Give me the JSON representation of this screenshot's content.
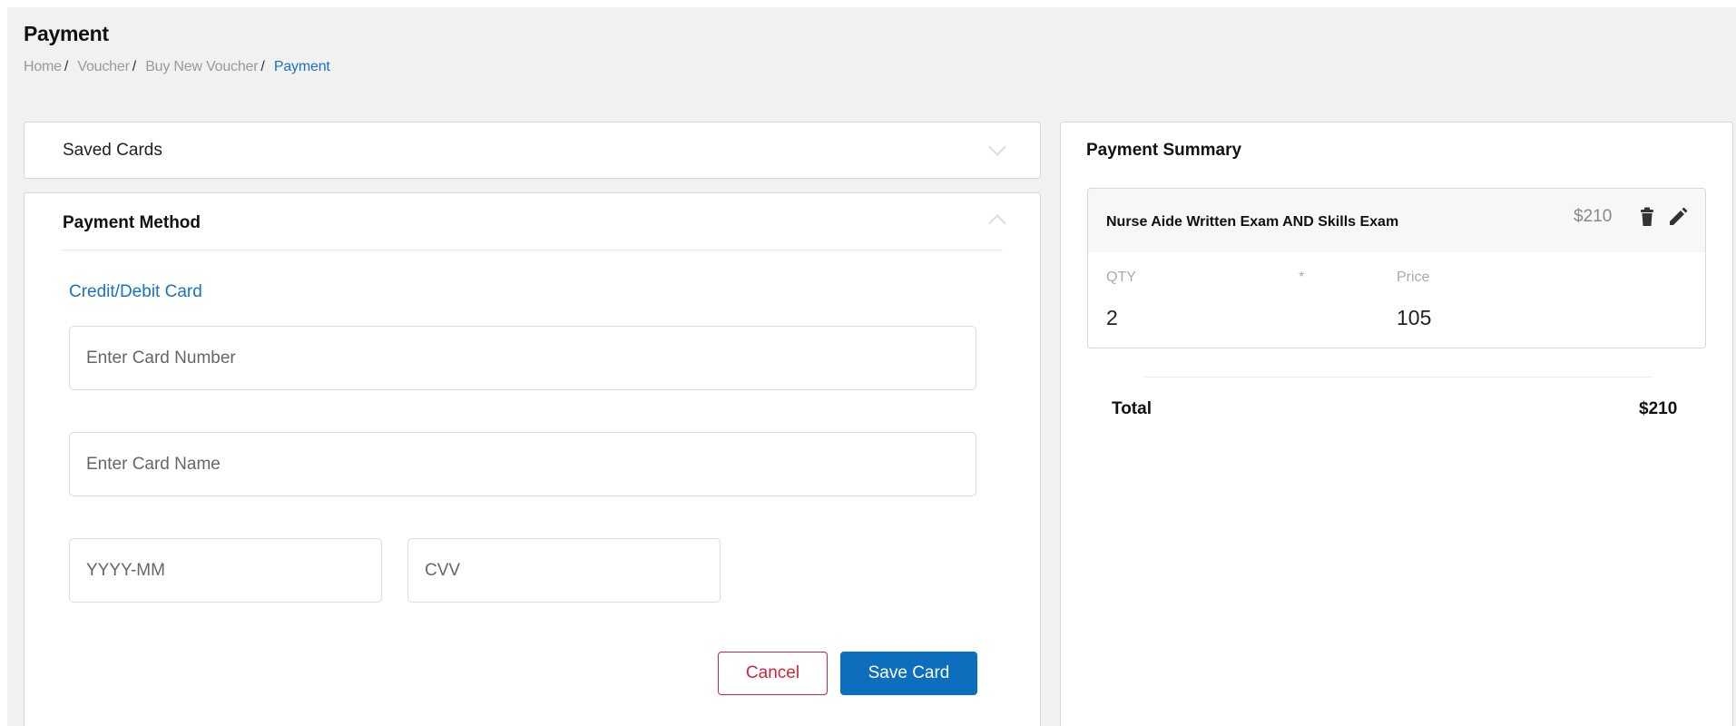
{
  "header": {
    "title": "Payment",
    "breadcrumb": [
      "Home",
      "Voucher",
      "Buy New Voucher",
      "Payment"
    ]
  },
  "saved_cards": {
    "label": "Saved Cards",
    "icon": "chevron-down-icon"
  },
  "payment_method": {
    "label": "Payment Method",
    "icon": "chevron-up-icon",
    "method": "Credit/Debit Card",
    "fields": {
      "card_number": {
        "placeholder": "Enter Card Number",
        "value": ""
      },
      "card_name": {
        "placeholder": "Enter Card Name",
        "value": ""
      },
      "expiry": {
        "placeholder": "YYYY-MM",
        "value": ""
      },
      "cvv": {
        "placeholder": "CVV",
        "value": ""
      }
    },
    "cancel_label": "Cancel",
    "save_label": "Save Card"
  },
  "summary": {
    "title": "Payment Summary",
    "item": {
      "name": "Nurse Aide Written Exam AND Skills Exam",
      "price": "$210",
      "qty_label": "QTY",
      "times": "*",
      "price_label": "Price",
      "qty": "2",
      "unit_price": "105",
      "icons": [
        "trash-icon",
        "pencil-icon"
      ]
    },
    "total_label": "Total",
    "total_value": "$210"
  },
  "colors": {
    "accent": "#1a73c2",
    "primary_button": "#0d6ebd",
    "cancel": "#d0263a",
    "page_bg": "#f1f1f1"
  }
}
